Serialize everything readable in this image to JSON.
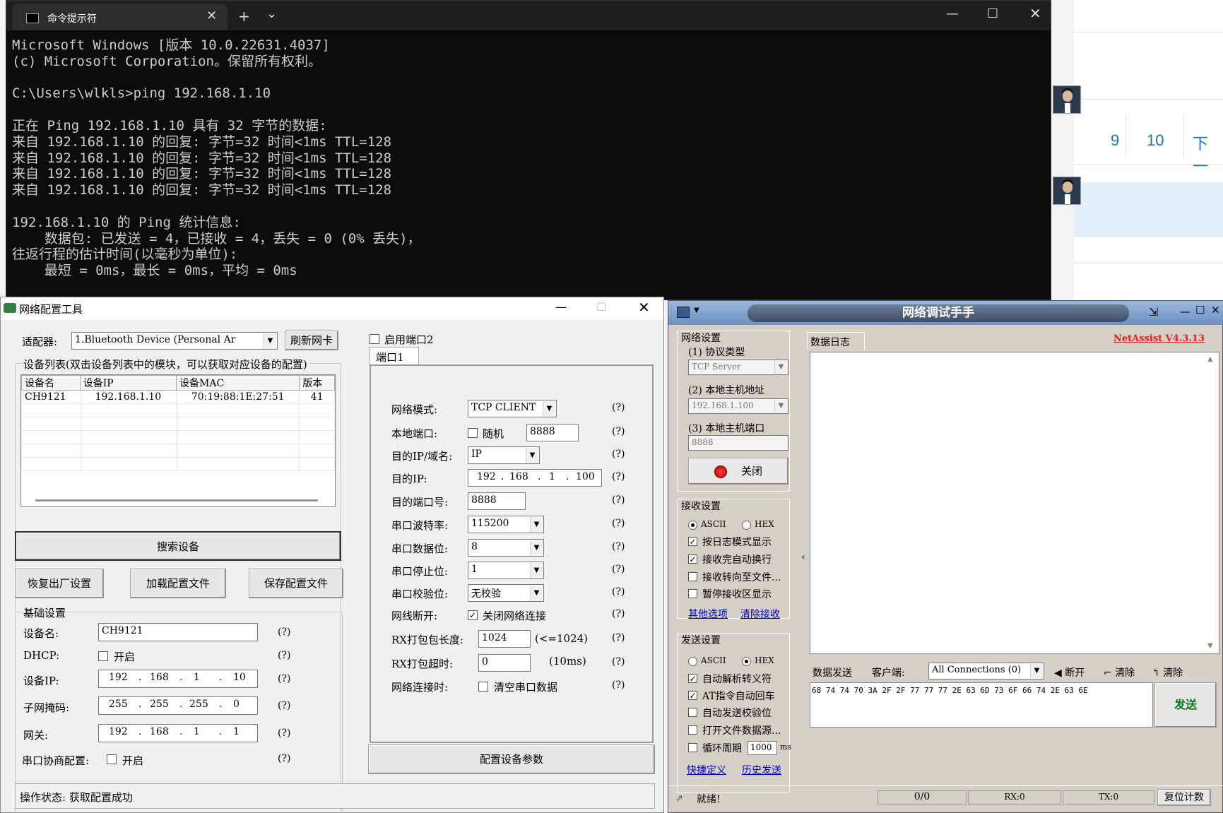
{
  "bg_page": {
    "pagination": [
      "9",
      "10",
      "下一"
    ]
  },
  "cmd": {
    "tab_title": "命令提示符",
    "new_tab": "+",
    "tab_menu": "⌄",
    "lines": [
      "Microsoft Windows [版本 10.0.22631.4037]",
      "(c) Microsoft Corporation。保留所有权利。",
      "",
      "C:\\Users\\wlkls>ping 192.168.1.10",
      "",
      "正在 Ping 192.168.1.10 具有 32 字节的数据:",
      "来自 192.168.1.10 的回复: 字节=32 时间<1ms TTL=128",
      "来自 192.168.1.10 的回复: 字节=32 时间<1ms TTL=128",
      "来自 192.168.1.10 的回复: 字节=32 时间<1ms TTL=128",
      "来自 192.168.1.10 的回复: 字节=32 时间<1ms TTL=128",
      "",
      "192.168.1.10 的 Ping 统计信息:",
      "    数据包: 已发送 = 4，已接收 = 4，丢失 = 0 (0% 丢失)，",
      "往返行程的估计时间(以毫秒为单位):",
      "    最短 = 0ms，最长 = 0ms，平均 = 0ms"
    ]
  },
  "cfg": {
    "title": "网络配置工具",
    "adapter_label": "适配器:",
    "adapter_value": "1.Bluetooth Device (Personal Ar",
    "refresh_btn": "刷新网卡",
    "enable_port2": "启用端口2",
    "port1_tab": "端口1",
    "device_list_title": "设备列表(双击设备列表中的模块，可以获取对应设备的配置)",
    "table_headers": [
      "设备名",
      "设备IP",
      "设备MAC",
      "版本"
    ],
    "table_rows": [
      [
        "CH9121",
        "192.168.1.10",
        "70:19:88:1E:27:51",
        "41"
      ]
    ],
    "search_btn": "搜索设备",
    "restore_btn": "恢复出厂设置",
    "load_btn": "加载配置文件",
    "save_btn": "保存配置文件",
    "basic_title": "基础设置",
    "device_name_label": "设备名:",
    "device_name": "CH9121",
    "dhcp_label": "DHCP:",
    "dhcp_enable": "开启",
    "device_ip_label": "设备IP:",
    "device_ip": [
      "192",
      "168",
      "1",
      "10"
    ],
    "mask_label": "子网掩码:",
    "mask": [
      "255",
      "255",
      "255",
      "0"
    ],
    "gateway_label": "网关:",
    "gateway": [
      "192",
      "168",
      "1",
      "1"
    ],
    "serial_neg_label": "串口协商配置:",
    "serial_neg_enable": "开启",
    "help": "(?)",
    "net_mode_label": "网络模式:",
    "net_mode": "TCP CLIENT",
    "local_port_label": "本地端口:",
    "random_label": "随机",
    "local_port": "8888",
    "dest_ip_domain_label": "目的IP/域名:",
    "dest_ip_domain": "IP",
    "dest_ip_label": "目的IP:",
    "dest_ip": [
      "192",
      "168",
      "1",
      "100"
    ],
    "dest_port_label": "目的端口号:",
    "dest_port": "8888",
    "baud_label": "串口波特率:",
    "baud": "115200",
    "databits_label": "串口数据位:",
    "databits": "8",
    "stopbits_label": "串口停止位:",
    "stopbits": "1",
    "parity_label": "串口校验位:",
    "parity": "无校验",
    "disconnect_label": "网线断开:",
    "disconnect_opt": "关闭网络连接",
    "rx_len_label": "RX打包包长度:",
    "rx_len": "1024",
    "rx_len_hint": "(<=1024)",
    "rx_timeout_label": "RX打包超时:",
    "rx_timeout": "0",
    "rx_timeout_hint": "(10ms)",
    "on_connect_label": "网络连接时:",
    "on_connect_opt": "清空串口数据",
    "config_btn": "配置设备参数",
    "status": "操作状态: 获取配置成功"
  },
  "na": {
    "title": "网络调试手手",
    "version": "NetAssist V4.3.13",
    "net_settings": "网络设置",
    "proto_label": "(1) 协议类型",
    "proto": "TCP Server",
    "host_label": "(2) 本地主机地址",
    "host": "192.168.1.100",
    "port_label": "(3) 本地主机端口",
    "port": "8888",
    "close_btn": "关闭",
    "recv_settings": "接收设置",
    "ascii": "ASCII",
    "hex": "HEX",
    "recv_opts": [
      "按日志模式显示",
      "接收完自动换行",
      "接收转向至文件...",
      "暂停接收区显示"
    ],
    "more_opts": "其他选项",
    "clear_recv": "清除接收",
    "send_settings": "发送设置",
    "send_opts": [
      "自动解析转义符",
      "AT指令自动回车",
      "自动发送校验位",
      "打开文件数据源...",
      "循环周期"
    ],
    "period": "1000",
    "ms": "ms",
    "shortcut": "快捷定义",
    "history": "历史发送",
    "log_tab": "数据日志",
    "send_tab": "数据发送",
    "client_label": "客户端:",
    "client_value": "All Connections (0)",
    "disconnect_btn": "断开",
    "clear1": "清除",
    "clear2": "清除",
    "send_data": "68 74 74 70 3A 2F 2F 77 77 77 2E 63 6D 73 6F 66 74 2E 63 6E",
    "send_btn": "发送",
    "ready": "就绪!",
    "counter": "0/0",
    "rx": "RX:0",
    "tx": "TX:0",
    "reset": "复位计数"
  }
}
